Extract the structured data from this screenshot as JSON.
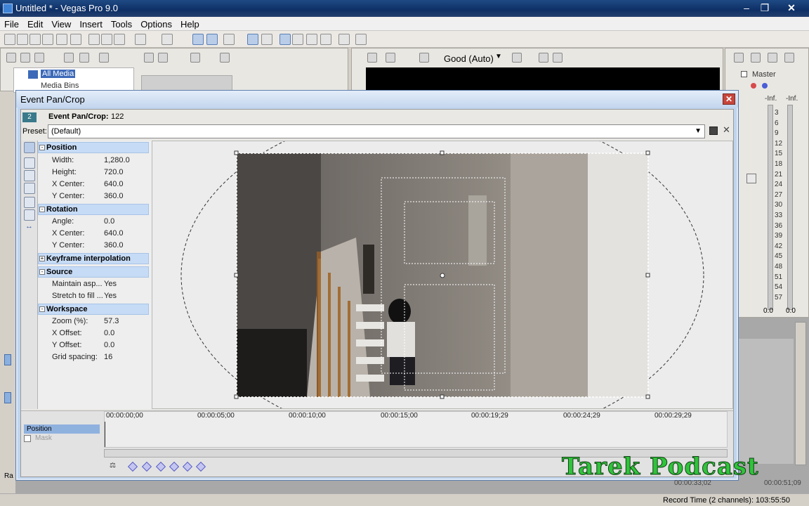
{
  "window": {
    "title": "Untitled * - Vegas Pro 9.0"
  },
  "menu": [
    "File",
    "Edit",
    "View",
    "Insert",
    "Tools",
    "Options",
    "Help"
  ],
  "explorer": {
    "items": [
      "All Media",
      "Media Bins"
    ]
  },
  "preview": {
    "quality": "Good (Auto)"
  },
  "mixer": {
    "label": "Master",
    "left_inf": "-Inf.",
    "right_inf": "-Inf.",
    "scale": [
      "3",
      "6",
      "9",
      "12",
      "15",
      "18",
      "21",
      "24",
      "27",
      "30",
      "33",
      "36",
      "39",
      "42",
      "45",
      "48",
      "51",
      "54",
      "57"
    ],
    "left_value": "0.0",
    "right_value": "0.0"
  },
  "dialog": {
    "title": "Event Pan/Crop",
    "header_label": "Event Pan/Crop:",
    "header_value": "122",
    "tab_number": "2",
    "preset_label": "Preset:",
    "preset_value": "(Default)",
    "sections": {
      "position": {
        "title": "Position",
        "props": [
          [
            "Width:",
            "1,280.0"
          ],
          [
            "Height:",
            "720.0"
          ],
          [
            "X Center:",
            "640.0"
          ],
          [
            "Y Center:",
            "360.0"
          ]
        ]
      },
      "rotation": {
        "title": "Rotation",
        "props": [
          [
            "Angle:",
            "0.0"
          ],
          [
            "X Center:",
            "640.0"
          ],
          [
            "Y Center:",
            "360.0"
          ]
        ]
      },
      "keyframe": {
        "title": "Keyframe interpolation"
      },
      "source": {
        "title": "Source",
        "props": [
          [
            "Maintain asp...",
            "Yes"
          ],
          [
            "Stretch to fill ...",
            "Yes"
          ]
        ]
      },
      "workspace": {
        "title": "Workspace",
        "props": [
          [
            "Zoom (%):",
            "57.3"
          ],
          [
            "X Offset:",
            "0.0"
          ],
          [
            "Y Offset:",
            "0.0"
          ],
          [
            "Grid spacing:",
            "16"
          ]
        ]
      }
    },
    "timeline": {
      "ruler": [
        "00:00:00;00",
        "00:00:05;00",
        "00:00:10;00",
        "00:00:15;00",
        "00:00:19;29",
        "00:00:24;29",
        "00:00:29;29"
      ],
      "tracks": [
        "Position",
        "Mask"
      ]
    }
  },
  "watermark": "Tarek Podcast",
  "status": {
    "record_time": "Record Time (2 channels): 103:55:50",
    "time1": "00:00:33;02",
    "time2": "00:00:51;09",
    "rate": "Ra"
  }
}
